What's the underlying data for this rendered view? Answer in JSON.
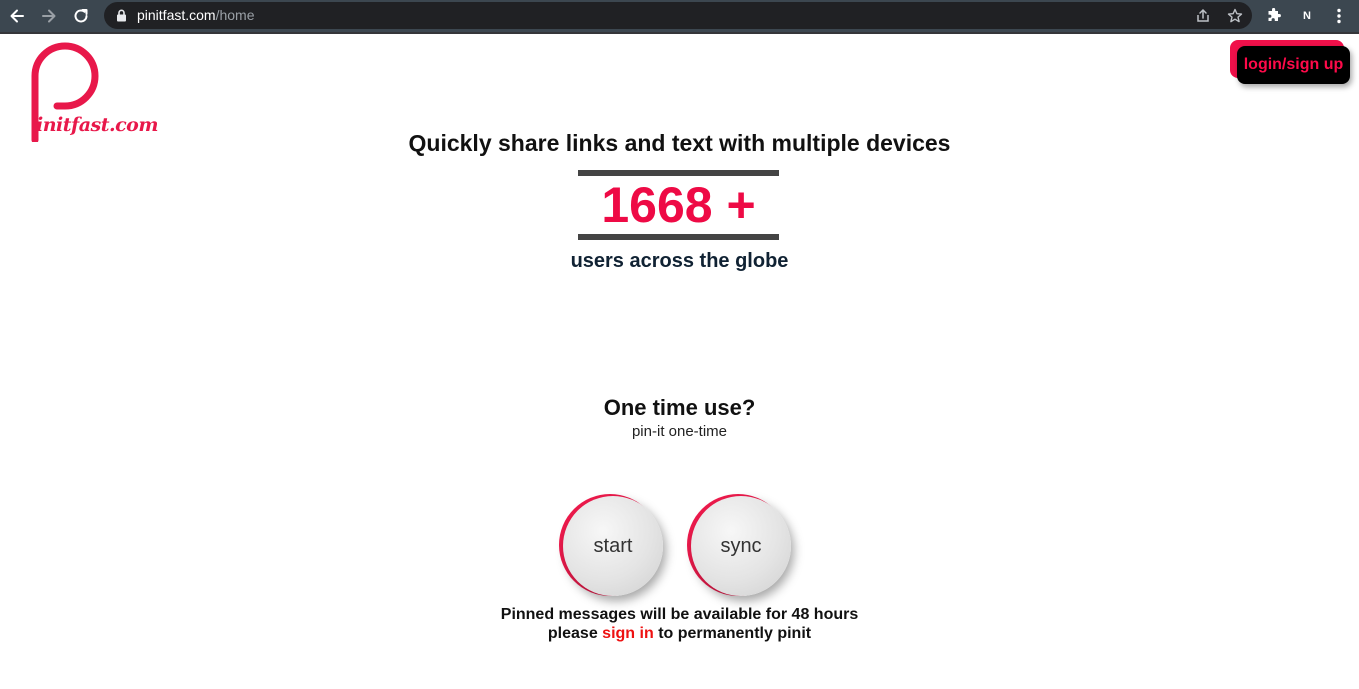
{
  "browser": {
    "url_host": "pinitfast.com",
    "url_path": "/home",
    "profile_initial": "N",
    "icons": [
      "back-arrow-icon",
      "forward-arrow-icon",
      "reload-icon",
      "lock-icon",
      "share-icon",
      "star-icon",
      "extensions-icon",
      "kebab-menu-icon"
    ]
  },
  "brand": {
    "logo_text": "initfast.com",
    "color": "#e8184a"
  },
  "header": {
    "login_label": "login/sign up"
  },
  "hero": {
    "headline": "Quickly share links and text with multiple devices",
    "count": "1668 +",
    "count_caption": "users across the globe"
  },
  "one_time": {
    "title": "One time use?",
    "subtitle": "pin-it one-time",
    "start_label": "start",
    "sync_label": "sync"
  },
  "note": {
    "line1": "Pinned messages will be available for 48 hours",
    "prefix": "please",
    "link": "sign in",
    "suffix": "to permanently pinit"
  },
  "colors": {
    "accent": "#ee0a45",
    "chrome": "#3c4750",
    "omnibox": "#202124"
  }
}
